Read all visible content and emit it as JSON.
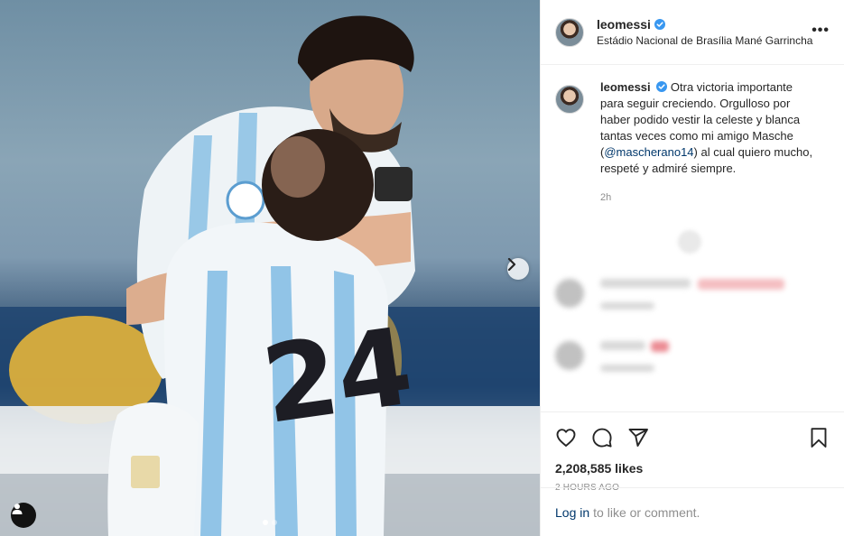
{
  "post": {
    "username": "leomessi",
    "location": "Estádio Nacional de Brasília Mané Garrincha",
    "caption_pre": "Otra victoria importante para seguir creciendo. Orgulloso por haber podido vestir la celeste y blanca tantas veces como mi amigo Masche (",
    "caption_mention": "@mascherano14",
    "caption_post": ") al cual quiero mucho, respeté y admiré siempre.",
    "caption_age": "2h",
    "likes": "2,208,585 likes",
    "timestamp": "2 HOURS AGO",
    "jersey_number": "24"
  },
  "login": {
    "link": "Log in",
    "text": "to like or comment."
  },
  "icons": {
    "verified": "verified-badge-icon",
    "more": "more-options-icon",
    "like": "heart-icon",
    "comment": "comment-bubble-icon",
    "share": "paper-plane-icon",
    "save": "bookmark-icon",
    "next": "chevron-right-icon",
    "tags": "user-tag-icon"
  },
  "colors": {
    "link": "#00376b",
    "verified": "#3897f0",
    "muted": "#8e8e8e"
  },
  "carousel": {
    "slides": 2,
    "active": 1
  }
}
